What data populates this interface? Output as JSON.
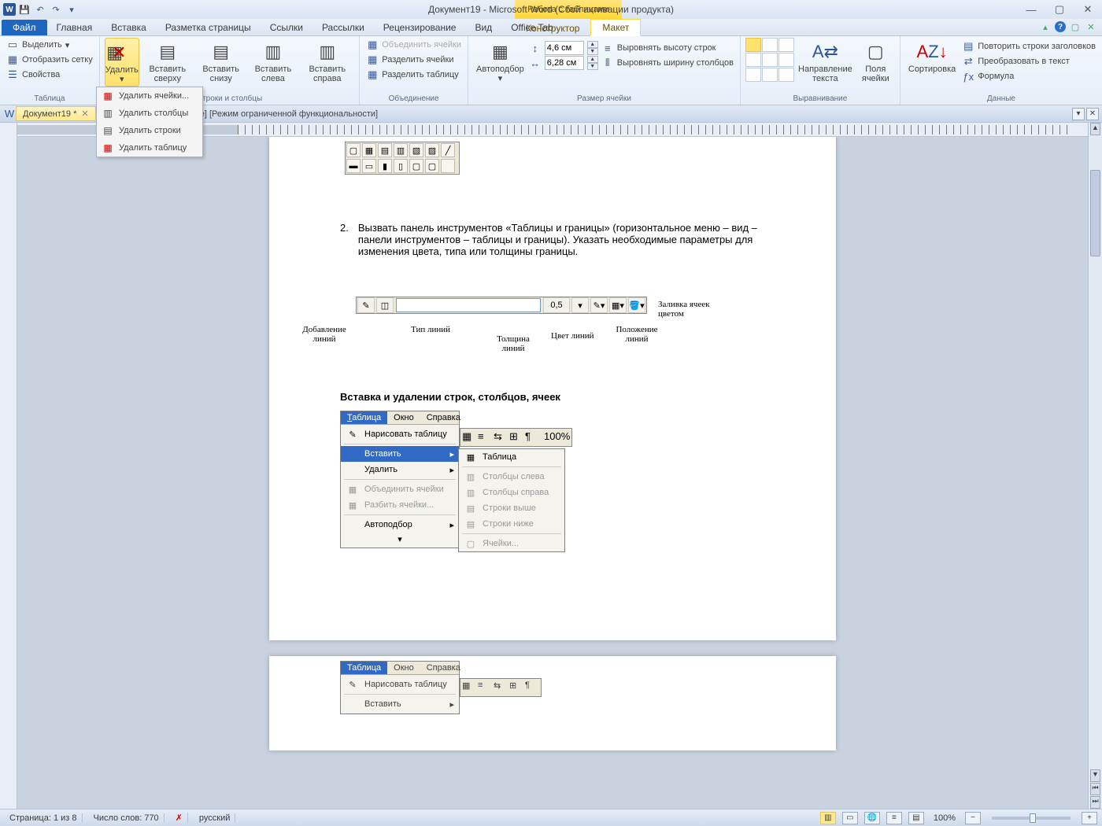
{
  "title": "Документ19  -  Microsoft Word (Сбой активации продукта)",
  "contextual_title": "Работа с таблицами",
  "tabs": {
    "file": "Файл",
    "list": [
      "Главная",
      "Вставка",
      "Разметка страницы",
      "Ссылки",
      "Рассылки",
      "Рецензирование",
      "Вид",
      "Office Tab"
    ],
    "ctx": [
      "Конструктор",
      "Макет"
    ]
  },
  "ribbon": {
    "table": {
      "label": "Таблица",
      "select": "Выделить",
      "gridlines": "Отобразить сетку",
      "properties": "Свойства"
    },
    "rowscols": {
      "label": "Строки и столбцы",
      "delete": "Удалить",
      "ins_above": "Вставить сверху",
      "ins_below": "Вставить снизу",
      "ins_left": "Вставить слева",
      "ins_right": "Вставить справа"
    },
    "merge": {
      "label": "Объединение",
      "merge_cells": "Объединить ячейки",
      "split_cells": "Разделить ячейки",
      "split_table": "Разделить таблицу"
    },
    "cellsize": {
      "label": "Размер ячейки",
      "autofit": "Автоподбор",
      "height": "4,6 см",
      "width": "6,28 см",
      "dist_rows": "Выровнять высоту строк",
      "dist_cols": "Выровнять ширину столбцов"
    },
    "align": {
      "label": "Выравнивание",
      "text_dir": "Направление текста",
      "margins": "Поля ячейки"
    },
    "data": {
      "label": "Данные",
      "sort": "Сортировка",
      "repeat_header": "Повторить строки заголовков",
      "to_text": "Преобразовать в текст",
      "formula": "Формула"
    }
  },
  "delete_menu": [
    "Удалить ячейки...",
    "Удалить столбцы",
    "Удалить строки",
    "Удалить таблицу"
  ],
  "doctabs": {
    "active": "Документ19 *",
    "second_suffix": "аботы.doc [только чтение] [Режим ограниченной функциональности]"
  },
  "doc": {
    "para2_num": "2.",
    "para2": "Вызвать панель инструментов «Таблицы и границы» (горизонтальное меню – вид – панели инструментов – таблицы и границы). Указать необходимые параметры для изменения цвета, типа или толщины границы.",
    "toolbar_width_val": "0,5",
    "annot_addlines": "Добавление линий",
    "annot_linetype": "Тип линий",
    "annot_thickness": "Толщина линий",
    "annot_color": "Цвет линий",
    "annot_pos": "Положение линий",
    "annot_fill": "Заливка ячеек цветом",
    "heading": "Вставка и удалении строк, столбцов, ячеек",
    "menu_bar": [
      "Таблица",
      "Окно",
      "Справка"
    ],
    "menu_items": {
      "draw": "Нарисовать таблицу",
      "insert": "Вставить",
      "delete": "Удалить",
      "merge": "Объединить ячейки",
      "split": "Разбить ячейки...",
      "autofit": "Автоподбор"
    },
    "submenu": [
      "Таблица",
      "Столбцы слева",
      "Столбцы справа",
      "Строки выше",
      "Строки ниже",
      "Ячейки..."
    ],
    "zoom_val": "100%"
  },
  "status": {
    "page": "Страница: 1 из 8",
    "words": "Число слов: 770",
    "lang": "русский",
    "zoom": "100%"
  }
}
